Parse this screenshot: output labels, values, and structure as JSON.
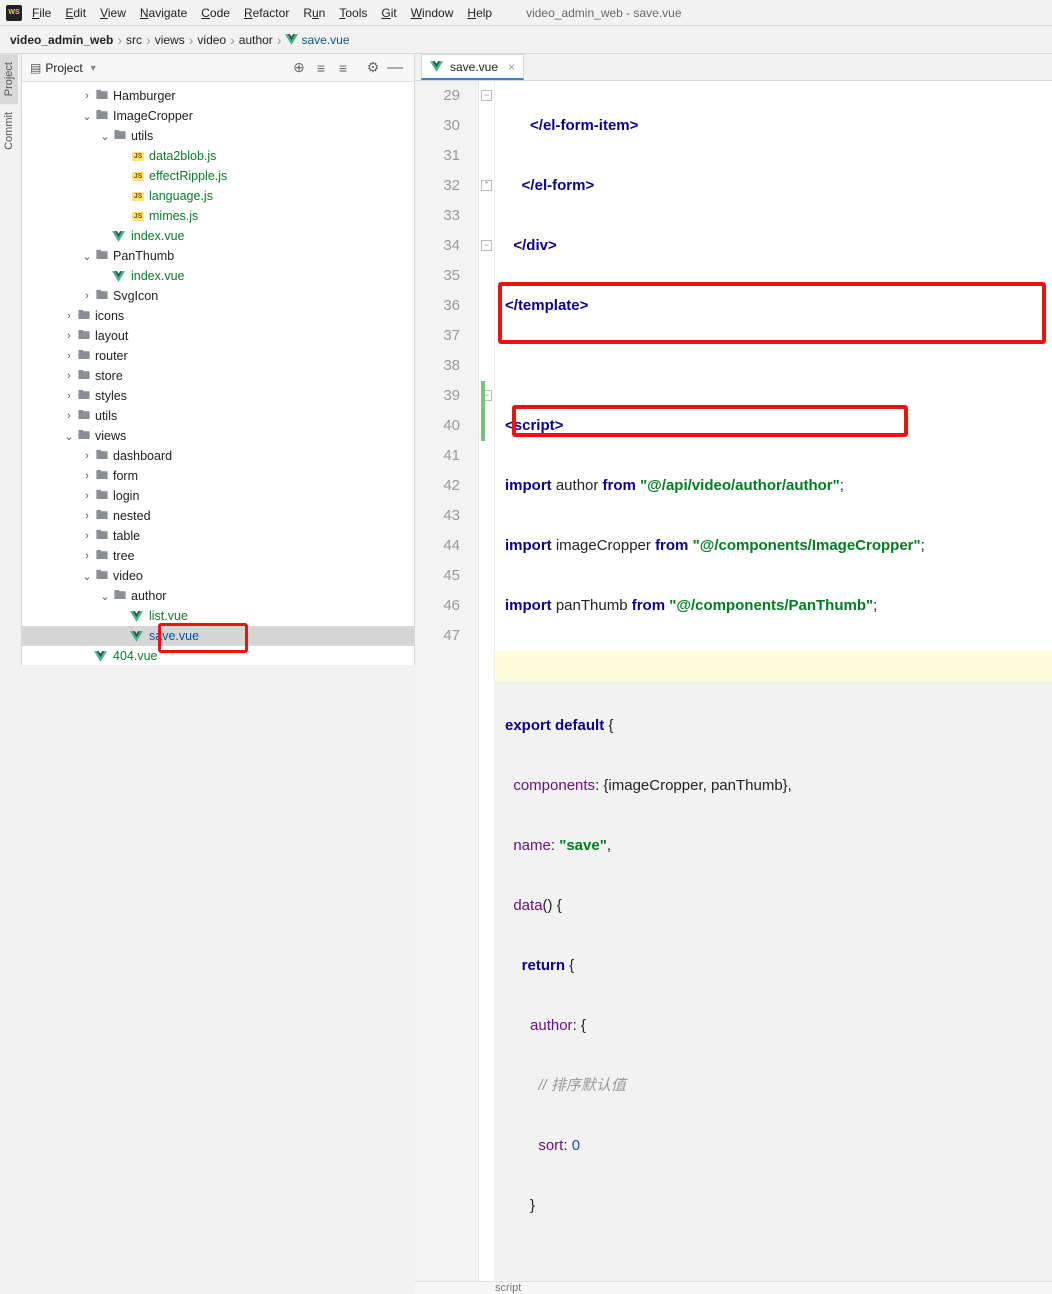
{
  "window": {
    "title": "video_admin_web - save.vue"
  },
  "menu": {
    "file": "File",
    "edit": "Edit",
    "view": "View",
    "navigate": "Navigate",
    "code": "Code",
    "refactor": "Refactor",
    "run": "Run",
    "tools": "Tools",
    "git": "Git",
    "window": "Window",
    "help": "Help"
  },
  "breadcrumb": {
    "root": "video_admin_web",
    "p1": "src",
    "p2": "views",
    "p3": "video",
    "p4": "author",
    "file": "save.vue"
  },
  "gutter": {
    "project": "Project",
    "commit": "Commit"
  },
  "projectPane": {
    "title": "Project"
  },
  "tree": {
    "hamburger": "Hamburger",
    "imageCropper": "ImageCropper",
    "utils": "utils",
    "data2blob": "data2blob.js",
    "effectRipple": "effectRipple.js",
    "language": "language.js",
    "mimes": "mimes.js",
    "indexVue1": "index.vue",
    "panThumb": "PanThumb",
    "indexVue2": "index.vue",
    "svgIcon": "SvgIcon",
    "icons": "icons",
    "layout": "layout",
    "router": "router",
    "store": "store",
    "styles": "styles",
    "utils2": "utils",
    "views": "views",
    "dashboard": "dashboard",
    "form": "form",
    "login": "login",
    "nested": "nested",
    "table": "table",
    "tree": "tree",
    "video": "video",
    "author": "author",
    "listVue": "list.vue",
    "saveVue": "save.vue",
    "v404": "404.vue"
  },
  "editor": {
    "tab": "save.vue",
    "lines": {
      "l29": {
        "n": "29"
      },
      "l30": {
        "n": "30"
      },
      "l31": {
        "n": "31"
      },
      "l32": {
        "n": "32"
      },
      "l33": {
        "n": "33"
      },
      "l34": {
        "n": "34"
      },
      "l35": {
        "n": "35"
      },
      "l36": {
        "n": "36"
      },
      "l37": {
        "n": "37"
      },
      "l38": {
        "n": "38"
      },
      "l39": {
        "n": "39"
      },
      "l40": {
        "n": "40"
      },
      "l41": {
        "n": "41"
      },
      "l42": {
        "n": "42"
      },
      "l43": {
        "n": "43"
      },
      "l44": {
        "n": "44"
      },
      "l45": {
        "n": "45"
      },
      "l46": {
        "n": "46"
      },
      "l47": {
        "n": "47"
      }
    },
    "code": {
      "c29a": "</",
      "c29b": "el-form-item",
      "c29c": ">",
      "c30a": "</",
      "c30b": "el-form",
      "c30c": ">",
      "c31a": "</",
      "c31b": "div",
      "c31c": ">",
      "c32a": "</",
      "c32b": "template",
      "c32c": ">",
      "c34a": "<",
      "c34b": "script",
      "c34c": ">",
      "c35a": "import",
      "c35b": " author ",
      "c35c": "from",
      "c35d": " ",
      "c35e": "\"@/api/video/author/author\"",
      "c35f": ";",
      "c36a": "import",
      "c36b": " imageCropper ",
      "c36c": "from",
      "c36d": " ",
      "c36e": "\"@/components/ImageCropper\"",
      "c36f": ";",
      "c37a": "import",
      "c37b": " panThumb ",
      "c37c": "from",
      "c37d": " ",
      "c37e": "\"@/components/PanThumb\"",
      "c37f": ";",
      "c39a": "export",
      "c39b": " ",
      "c39c": "default",
      "c39d": " {",
      "c40a": "components",
      "c40b": ": {imageCropper, panThumb},",
      "c41a": "name",
      "c41b": ": ",
      "c41c": "\"save\"",
      "c41d": ",",
      "c42a": "data",
      "c42b": "() {",
      "c43a": "return",
      "c43b": " {",
      "c44a": "author",
      "c44b": ": {",
      "c45a": "// 排序默认值",
      "c46a": "sort",
      "c46b": ": ",
      "c46c": "0",
      "c47a": "}"
    },
    "footer": "script"
  }
}
